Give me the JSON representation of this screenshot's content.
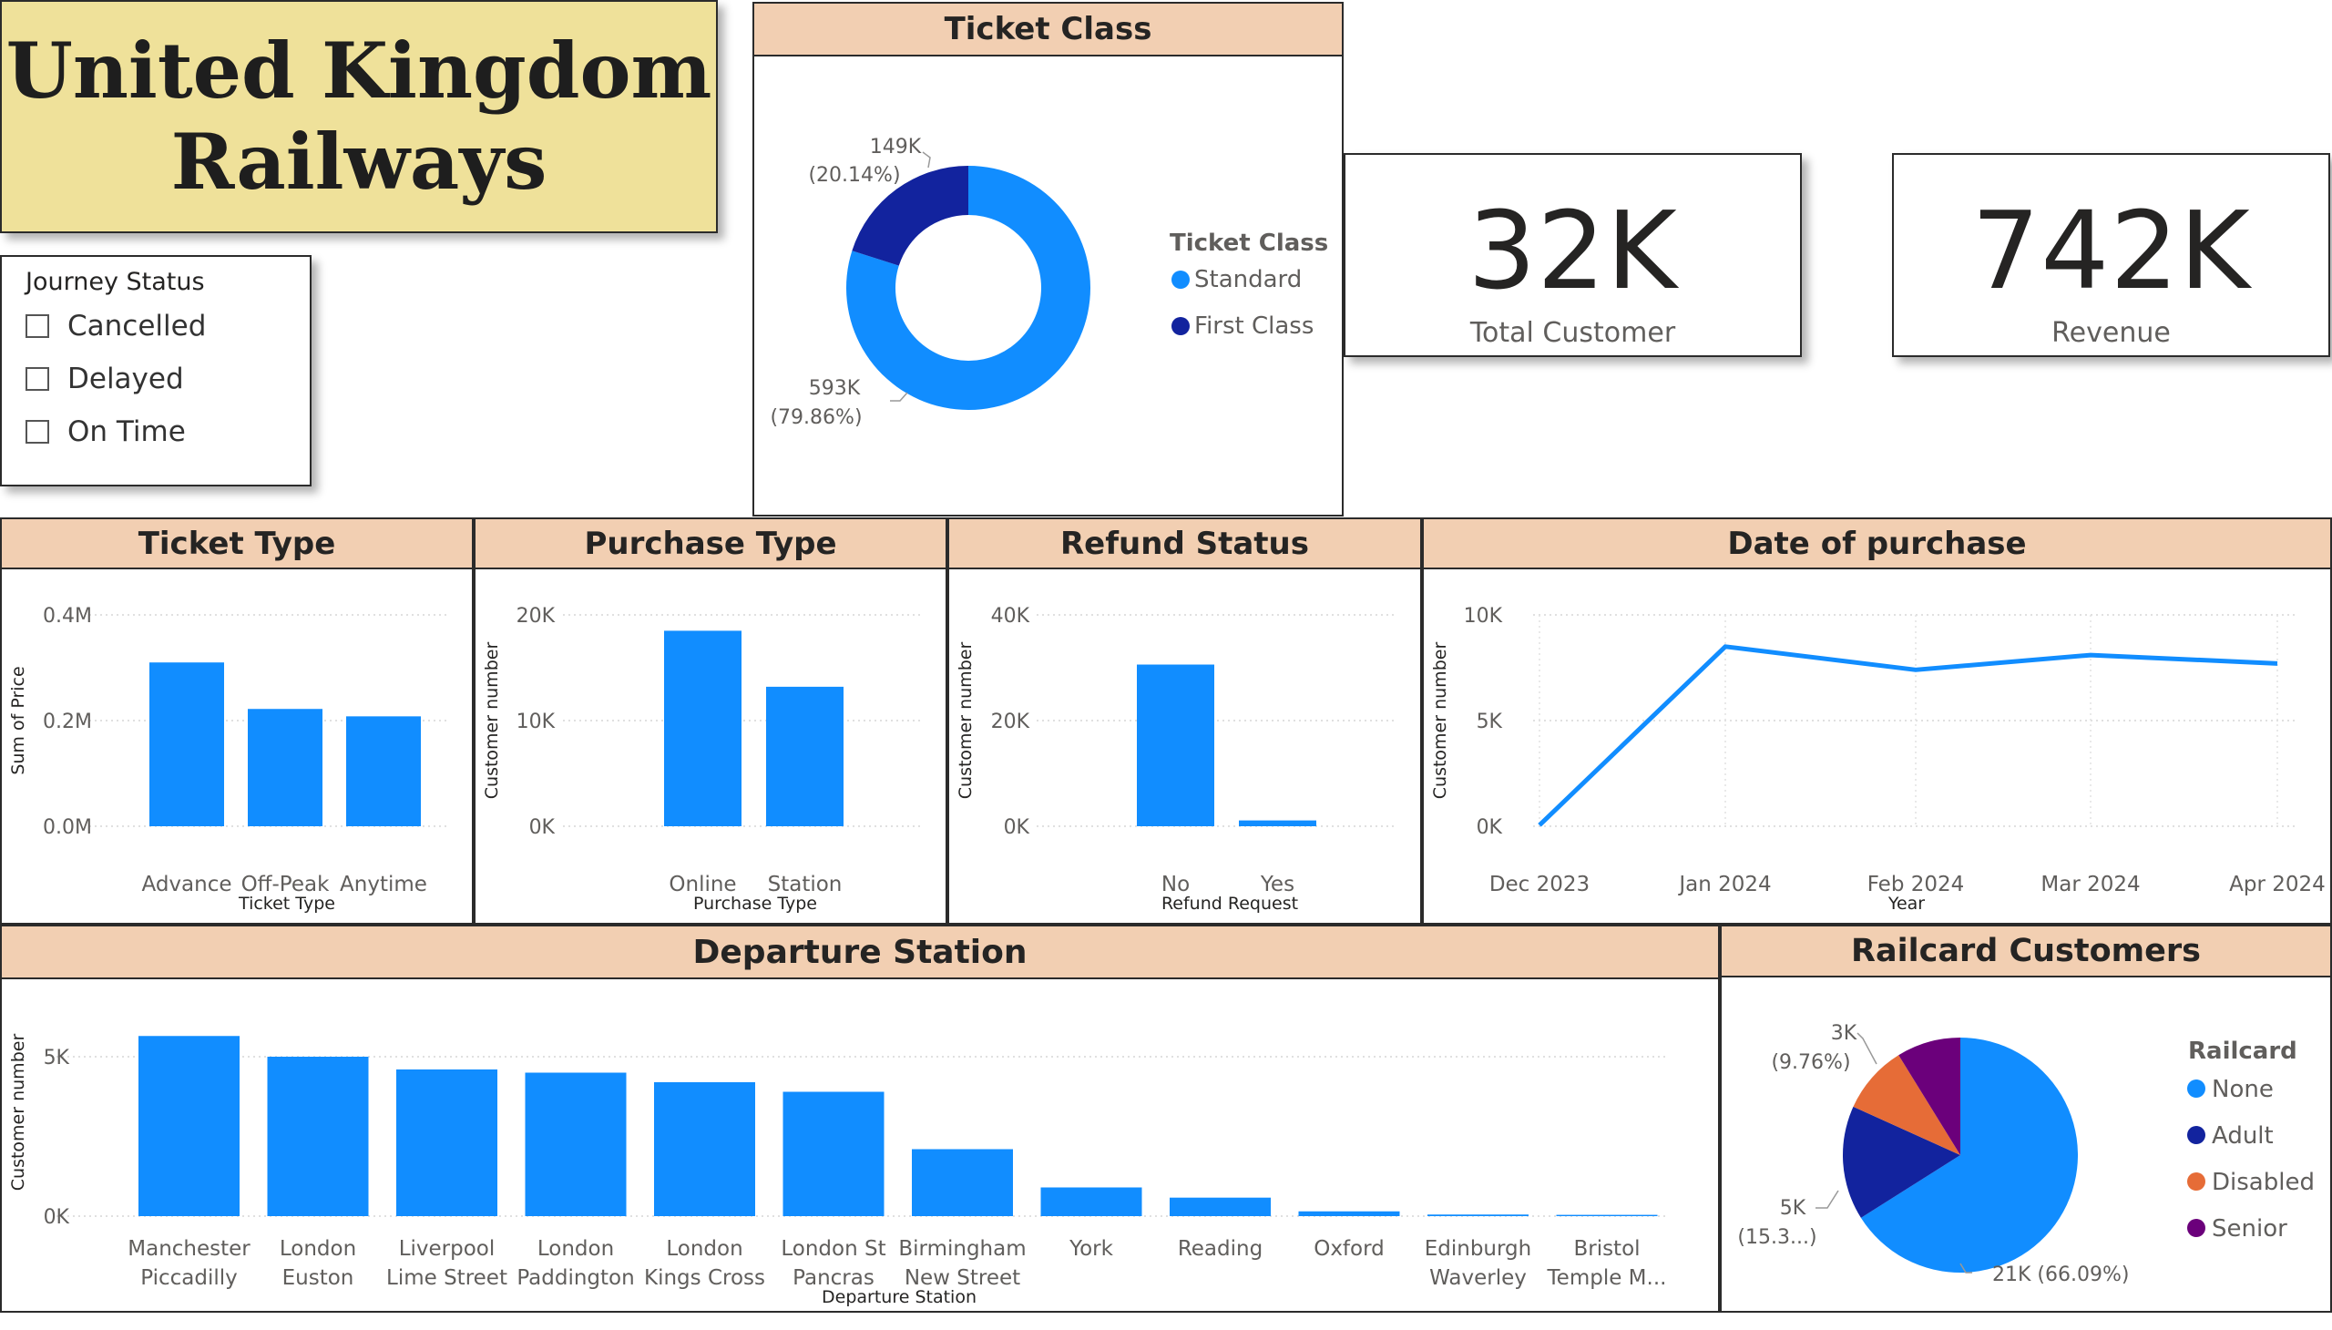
{
  "title": {
    "line1": "United Kingdom",
    "line2": "Railways"
  },
  "slicer": {
    "title": "Journey Status",
    "items": [
      "Cancelled",
      "Delayed",
      "On Time"
    ]
  },
  "cards": {
    "customers": {
      "value": "32K",
      "label": "Total Customer"
    },
    "revenue": {
      "value": "742K",
      "label": "Revenue"
    }
  },
  "colors": {
    "primary": "#118dff",
    "dark_blue": "#12239e",
    "orange": "#e66c37",
    "purple": "#6b007b",
    "header_bg": "#f2cfb2",
    "title_bg": "#efe19a"
  },
  "ticket_class": {
    "header": "Ticket Class",
    "legend_title": "Ticket Class",
    "labels": [
      {
        "value": "593K",
        "pct": "(79.86%)"
      },
      {
        "value": "149K",
        "pct": "(20.14%)"
      }
    ]
  },
  "ticket_type": {
    "header": "Ticket Type"
  },
  "purchase_type": {
    "header": "Purchase Type"
  },
  "refund_status": {
    "header": "Refund Status"
  },
  "date_purchase": {
    "header": "Date of purchase"
  },
  "departure": {
    "header": "Departure Station"
  },
  "railcard": {
    "header": "Railcard Customers",
    "legend_title": "Railcard",
    "labels": {
      "none": "21K (66.09%)",
      "adult_value": "5K",
      "adult_pct": "(15.3...)",
      "disabled_value": "3K",
      "disabled_pct": "(9.76%)"
    }
  },
  "chart_data": [
    {
      "id": "ticket_class",
      "type": "pie",
      "donut": true,
      "legend_title": "Ticket Class",
      "legend_position": "right",
      "series": [
        {
          "name": "Standard",
          "value": 593000,
          "percent": 79.86,
          "color": "#118dff"
        },
        {
          "name": "First Class",
          "value": 149000,
          "percent": 20.14,
          "color": "#12239e"
        }
      ]
    },
    {
      "id": "ticket_type",
      "type": "bar",
      "categories": [
        "Advance",
        "Off-Peak",
        "Anytime"
      ],
      "values": [
        310000,
        222000,
        208000
      ],
      "xlabel": "Ticket Type",
      "ylabel": "Sum of Price",
      "ylim": [
        0,
        400000
      ],
      "yticks": [
        0,
        200000,
        400000
      ],
      "ytick_labels": [
        "0.0M",
        "0.2M",
        "0.4M"
      ],
      "grid": true
    },
    {
      "id": "purchase_type",
      "type": "bar",
      "categories": [
        "Online",
        "Station"
      ],
      "values": [
        18500,
        13200
      ],
      "xlabel": "Purchase Type",
      "ylabel": "Customer number",
      "ylim": [
        0,
        20000
      ],
      "yticks": [
        0,
        10000,
        20000
      ],
      "ytick_labels": [
        "0K",
        "10K",
        "20K"
      ],
      "grid": true
    },
    {
      "id": "refund_status",
      "type": "bar",
      "categories": [
        "No",
        "Yes"
      ],
      "values": [
        30600,
        1100
      ],
      "xlabel": "Refund Request",
      "ylabel": "Customer number",
      "ylim": [
        0,
        40000
      ],
      "yticks": [
        0,
        20000,
        40000
      ],
      "ytick_labels": [
        "0K",
        "20K",
        "40K"
      ],
      "grid": true
    },
    {
      "id": "date_purchase",
      "type": "line",
      "x": [
        "Dec 2023",
        "Jan 2024",
        "Feb 2024",
        "Mar 2024",
        "Apr 2024"
      ],
      "values": [
        50,
        8500,
        7400,
        8100,
        7700
      ],
      "xlabel": "Year",
      "ylabel": "Customer number",
      "ylim": [
        0,
        10000
      ],
      "yticks": [
        0,
        5000,
        10000
      ],
      "ytick_labels": [
        "0K",
        "5K",
        "10K"
      ],
      "grid": true
    },
    {
      "id": "departure_station",
      "type": "bar",
      "categories": [
        [
          "Manchester",
          "Piccadilly"
        ],
        [
          "London",
          "Euston"
        ],
        [
          "Liverpool",
          "Lime Street"
        ],
        [
          "London",
          "Paddington"
        ],
        [
          "London",
          "Kings Cross"
        ],
        [
          "London St",
          "Pancras"
        ],
        [
          "Birmingham",
          "New Street"
        ],
        [
          "York"
        ],
        [
          "Reading"
        ],
        [
          "Oxford"
        ],
        [
          "Edinburgh",
          "Waverley"
        ],
        [
          "Bristol",
          "Temple M..."
        ]
      ],
      "values": [
        5650,
        5000,
        4600,
        4500,
        4200,
        3900,
        2100,
        900,
        580,
        150,
        50,
        40
      ],
      "xlabel": "Departure Station",
      "ylabel": "Customer number",
      "ylim": [
        0,
        6000
      ],
      "yticks": [
        0,
        5000
      ],
      "ytick_labels": [
        "0K",
        "5K"
      ],
      "grid": true
    },
    {
      "id": "railcard",
      "type": "pie",
      "legend_title": "Railcard",
      "legend_position": "right",
      "series": [
        {
          "name": "None",
          "value": 21000,
          "percent": 66.09,
          "color": "#118dff"
        },
        {
          "name": "Adult",
          "value": 5000,
          "percent": 15.3,
          "color": "#12239e"
        },
        {
          "name": "Disabled",
          "value": 3000,
          "percent": 9.76,
          "color": "#e66c37"
        },
        {
          "name": "Senior",
          "value": 2800,
          "percent": 8.85,
          "color": "#6b007b"
        }
      ]
    }
  ]
}
